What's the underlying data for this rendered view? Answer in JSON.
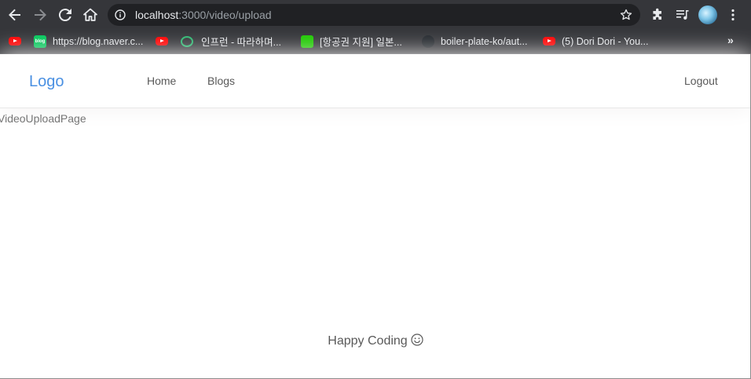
{
  "browser": {
    "address": {
      "host": "localhost",
      "path": ":3000/video/upload"
    },
    "bookmarks": [
      {
        "label": "",
        "icon": "youtube-icon"
      },
      {
        "label": "https://blog.naver.c...",
        "icon": "naver-blog-icon",
        "badge": "blog"
      },
      {
        "label": "",
        "icon": "youtube-icon"
      },
      {
        "label": "인프런 - 따라하며...",
        "icon": "inflearn-icon"
      },
      {
        "label": "[항공권 지원] 일본...",
        "icon": "green-app-icon"
      },
      {
        "label": "boiler-plate-ko/aut...",
        "icon": "github-icon"
      },
      {
        "label": "(5) Dori Dori - You...",
        "icon": "youtube-icon"
      }
    ],
    "more_label": "»"
  },
  "navbar": {
    "logo": "Logo",
    "items": [
      {
        "label": "Home"
      },
      {
        "label": "Blogs"
      }
    ],
    "logout": "Logout"
  },
  "main": {
    "page_label": "VideoUploadPage"
  },
  "footer": {
    "text": "Happy Coding",
    "icon": "smile-icon"
  },
  "colors": {
    "accent": "#4a90e2",
    "chrome": "#35363a",
    "omnibox": "#202124"
  }
}
